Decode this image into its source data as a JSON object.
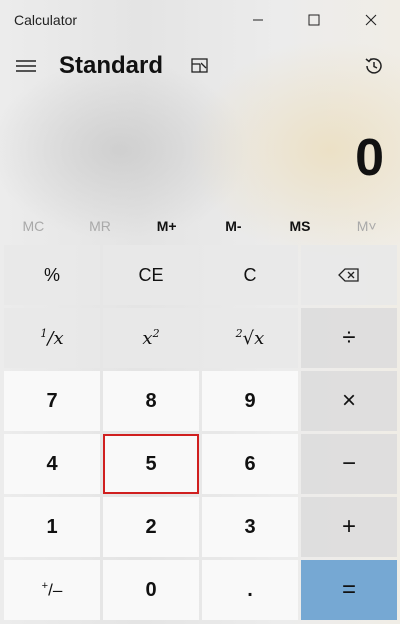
{
  "window": {
    "title": "Calculator"
  },
  "header": {
    "mode": "Standard"
  },
  "display": {
    "value": "0"
  },
  "memory": [
    {
      "label": "MC",
      "enabled": false
    },
    {
      "label": "MR",
      "enabled": false
    },
    {
      "label": "M+",
      "enabled": true
    },
    {
      "label": "M-",
      "enabled": true
    },
    {
      "label": "MS",
      "enabled": true
    },
    {
      "label": "M˅",
      "enabled": false
    }
  ],
  "keys": {
    "percent": "%",
    "ce": "CE",
    "c": "C",
    "reciprocal_num": "1",
    "reciprocal_den": "x",
    "square_base": "x",
    "square_exp": "2",
    "sqrt_index": "2",
    "sqrt_sym": "√",
    "sqrt_var": "x",
    "divide": "÷",
    "seven": "7",
    "eight": "8",
    "nine": "9",
    "multiply": "×",
    "four": "4",
    "five": "5",
    "six": "6",
    "minus": "−",
    "one": "1",
    "two": "2",
    "three": "3",
    "plus": "+",
    "negate_plus": "+",
    "negate_minus": "–",
    "zero": "0",
    "decimal": ".",
    "equals": "="
  },
  "colors": {
    "equals_key": "#76a8d3",
    "selection_outline": "#d01f1f"
  }
}
